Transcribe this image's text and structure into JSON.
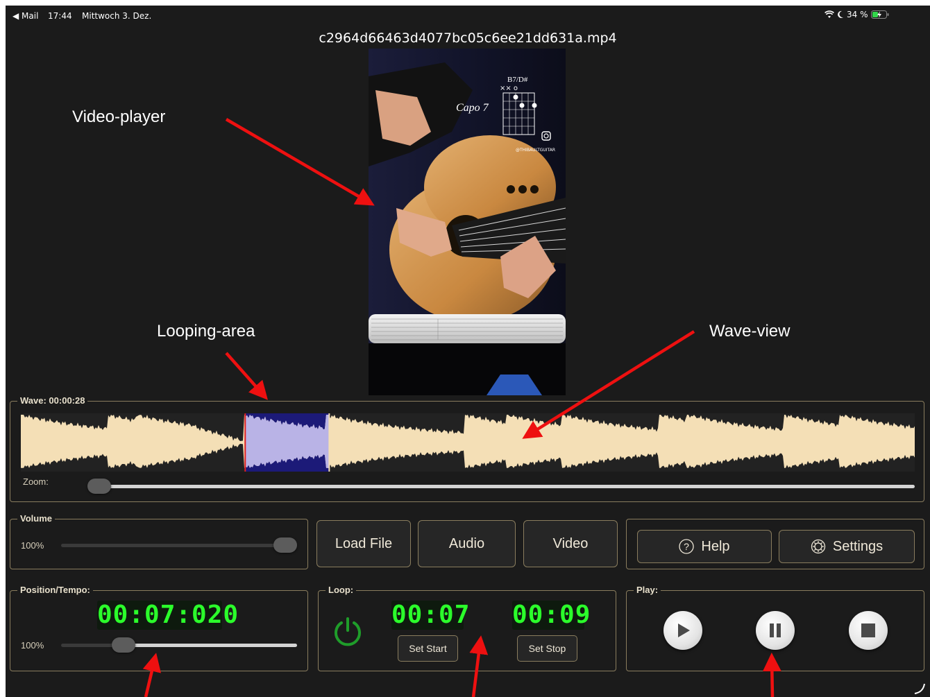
{
  "status_bar": {
    "back_label": "◀ Mail",
    "time": "17:44",
    "date": "Mittwoch 3. Dez.",
    "battery": "34 %"
  },
  "file": {
    "name": "c2964d66463d4077bc05c6ee21dd631a.mp4"
  },
  "annotations": {
    "video_player": "Video-player",
    "looping_area": "Looping-area",
    "wave_view": "Wave-view"
  },
  "video": {
    "chord_name": "B7/D#",
    "capo": "Capo 7",
    "handle": "@THIBAULTGUITAR",
    "chord_markers": "××     o"
  },
  "wave": {
    "title": "Wave: 00:00:28",
    "zoom_label": "Zoom:",
    "zoom_level": 0,
    "loop_start_fraction": 0.251,
    "loop_end_fraction": 0.345,
    "colors": {
      "wave": "#f4dfb6",
      "loop_bg": "#1c1a78",
      "loop_wave": "#b9b3e6",
      "marker": "#e02020"
    }
  },
  "volume": {
    "title": "Volume",
    "value_label": "100%",
    "level": 1.0
  },
  "file_buttons": {
    "load": "Load File",
    "audio": "Audio",
    "video": "Video"
  },
  "util_buttons": {
    "help": "Help",
    "settings": "Settings"
  },
  "position": {
    "title": "Position/Tempo:",
    "time": "00:07:020",
    "tempo_label": "100%",
    "progress": 0.25
  },
  "loop": {
    "title": "Loop:",
    "start": "00:07",
    "stop": "00:09",
    "set_start": "Set Start",
    "set_stop": "Set Stop",
    "power_color": "#1f9d2a"
  },
  "play": {
    "title": "Play:"
  },
  "icons": {
    "play": "play-icon",
    "pause": "pause-icon",
    "stop": "stop-icon",
    "help": "question-circle-icon",
    "settings": "gear-icon",
    "power": "power-icon"
  }
}
